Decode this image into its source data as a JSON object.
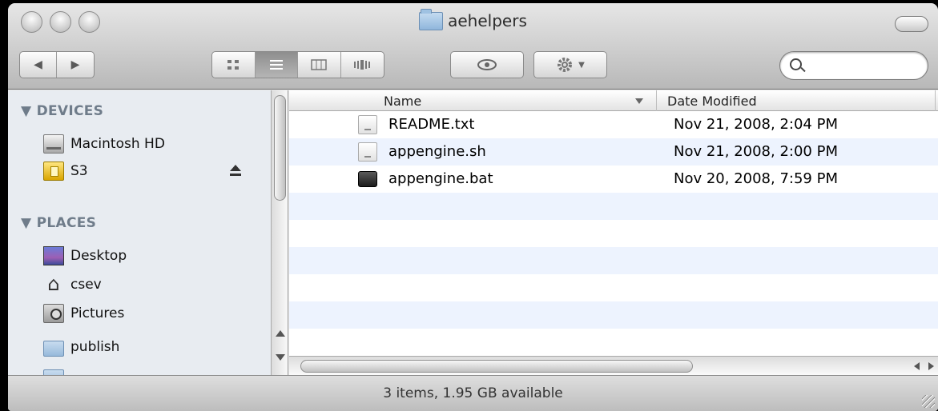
{
  "window": {
    "title": "aehelpers"
  },
  "toolbar": {
    "nav_back": "◀",
    "nav_forward": "▶",
    "view_icon": "icon-view-icon",
    "view_list": "list-view-icon",
    "view_column": "column-view-icon",
    "view_coverflow": "coverflow-view-icon",
    "quicklook": "eye-icon",
    "action": "gear-icon",
    "search_placeholder": ""
  },
  "sidebar": {
    "devices_header": "▼ DEVICES",
    "devices": [
      {
        "label": "Macintosh HD",
        "icon": "hard-disk-icon"
      },
      {
        "label": "S3",
        "icon": "disk-icon",
        "ejectable": true
      }
    ],
    "places_header": "▼ PLACES",
    "places": [
      {
        "label": "Desktop",
        "icon": "desktop-icon"
      },
      {
        "label": "csev",
        "icon": "home-icon"
      },
      {
        "label": "Pictures",
        "icon": "pictures-icon"
      },
      {
        "label": "publish",
        "icon": "folder-icon"
      }
    ]
  },
  "list": {
    "col_name": "Name",
    "col_date": "Date Modified",
    "files": [
      {
        "name": "README.txt",
        "date": "Nov 21, 2008, 2:04 PM",
        "icon": "text-file-icon"
      },
      {
        "name": "appengine.sh",
        "date": "Nov 21, 2008, 2:00 PM",
        "icon": "text-file-icon"
      },
      {
        "name": "appengine.bat",
        "date": "Nov 20, 2008, 7:59 PM",
        "icon": "black-file-icon"
      }
    ]
  },
  "status": {
    "text": "3 items, 1.95 GB available"
  },
  "colors": {
    "stripe": "#edf3fe",
    "sidebar_bg": "#e8ecf1",
    "sidebar_header": "#6f7c8a"
  }
}
